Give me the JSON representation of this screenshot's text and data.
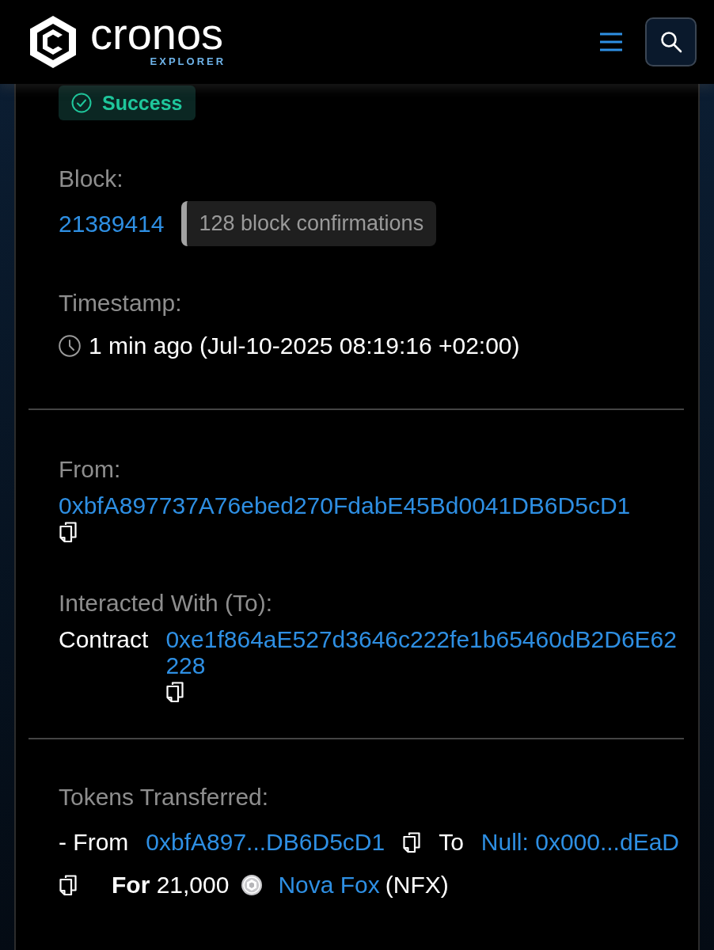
{
  "header": {
    "brand": "cronos",
    "brand_sub": "EXPLORER"
  },
  "status": {
    "label": "Success",
    "kind": "success"
  },
  "block": {
    "label": "Block:",
    "number": "21389414",
    "confirmations": "128 block confirmations"
  },
  "timestamp": {
    "label": "Timestamp:",
    "value": "1 min ago (Jul-10-2025 08:19:16 +02:00)"
  },
  "from": {
    "label": "From:",
    "address": "0xbfA897737A76ebed270FdabE45Bd0041DB6D5cD1"
  },
  "to": {
    "label": "Interacted With (To):",
    "type": "Contract",
    "address": "0xe1f864aE527d3646c222fe1b65460dB2D6E62228"
  },
  "tokens_transferred": {
    "label": "Tokens Transferred:",
    "transfers": [
      {
        "from_label": "- From",
        "from": "0xbfA897...DB6D5cD1",
        "to_label": "To",
        "to": "Null: 0x000...dEaD",
        "amount": "**For** 21,000",
        "token": "Nova Fox",
        "symbol": "(NFX)"
      }
    ]
  }
}
